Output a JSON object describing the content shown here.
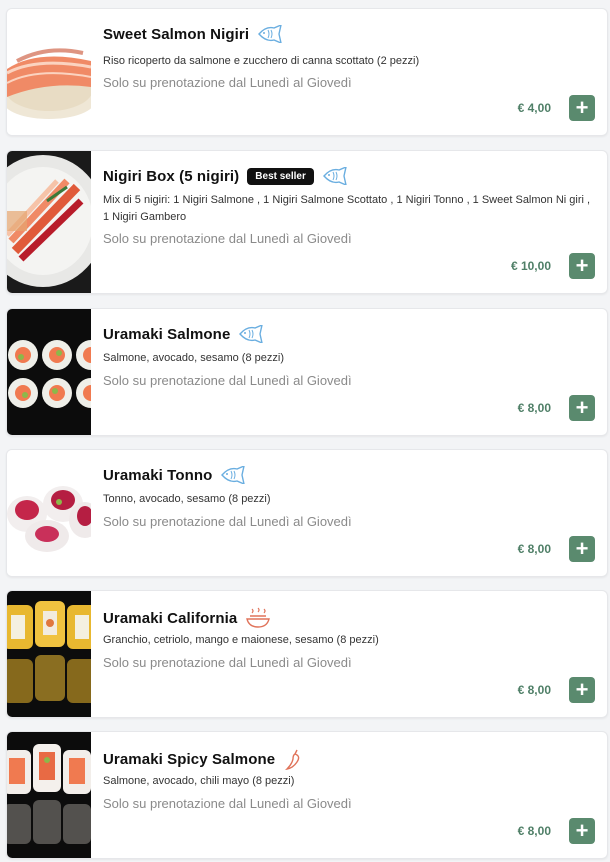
{
  "items": [
    {
      "name": "Sweet Salmon Nigiri",
      "description": "Riso ricoperto da salmone e zucchero di canna scottato (2 pezzi)",
      "availability": "Solo su prenotazione dal Lunedì al Giovedì",
      "price": "€ 4,00",
      "icon": "fish-icon",
      "badge": null
    },
    {
      "name": "Nigiri Box (5 nigiri)",
      "description": "Mix di 5 nigiri: 1 Nigiri Salmone , 1 Nigiri Salmone Scottato , 1 Nigiri Tonno , 1 Sweet Salmon Ni giri , 1 Nigiri Gambero",
      "availability": "Solo su prenotazione dal Lunedì al Giovedì",
      "price": "€ 10,00",
      "icon": "fish-icon",
      "badge": "Best seller"
    },
    {
      "name": "Uramaki Salmone",
      "description": "Salmone, avocado, sesamo (8 pezzi)",
      "availability": "Solo su prenotazione dal Lunedì al Giovedì",
      "price": "€ 8,00",
      "icon": "fish-icon",
      "badge": null
    },
    {
      "name": "Uramaki Tonno",
      "description": "Tonno, avocado, sesamo (8 pezzi)",
      "availability": "Solo su prenotazione dal Lunedì al Giovedì",
      "price": "€ 8,00",
      "icon": "fish-icon",
      "badge": null
    },
    {
      "name": "Uramaki California",
      "description": "Granchio, cetriolo, mango e maionese, sesamo (8 pezzi)",
      "availability": "Solo su prenotazione dal Lunedì al Giovedì",
      "price": "€ 8,00",
      "icon": "hot-dish-icon",
      "badge": null
    },
    {
      "name": "Uramaki Spicy Salmone",
      "description": "Salmone, avocado, chili mayo (8 pezzi)",
      "availability": "Solo su prenotazione dal Lunedì al Giovedì",
      "price": "€ 8,00",
      "icon": "chili-pepper-icon",
      "badge": null
    }
  ],
  "add_label": "+",
  "colors": {
    "accent": "#5a8a6e",
    "price": "#4f7f67",
    "fish_icon": "#6aaee0",
    "hot_icon": "#e0735a"
  }
}
